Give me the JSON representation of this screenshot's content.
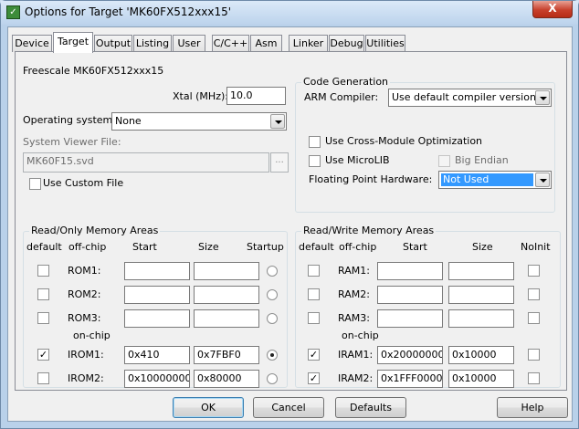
{
  "window": {
    "title": "Options for Target 'MK60FX512xxx15'",
    "close_glyph": "X"
  },
  "tabs": [
    "Device",
    "Target",
    "Output",
    "Listing",
    "User",
    "C/C++",
    "Asm",
    "Linker",
    "Debug",
    "Utilities"
  ],
  "active_tab": "Target",
  "target": {
    "device_name": "Freescale MK60FX512xxx15",
    "xtal_label": "Xtal (MHz):",
    "xtal_value": "10.0",
    "os_label": "Operating system:",
    "os_value": "None",
    "sv_file_label": "System Viewer File:",
    "sv_file_value": "MK60F15.svd",
    "browse_label": "...",
    "custom_file_label": "Use Custom File",
    "custom_file_checked": false
  },
  "code_generation": {
    "title": "Code Generation",
    "compiler_label": "ARM Compiler:",
    "compiler_value": "Use default compiler version",
    "cross_module_label": "Use Cross-Module Optimization",
    "cross_module_checked": false,
    "microlib_label": "Use MicroLIB",
    "microlib_checked": false,
    "big_endian_label": "Big Endian",
    "big_endian_checked": false,
    "fph_label": "Floating Point Hardware:",
    "fph_value": "Not Used"
  },
  "rom": {
    "title": "Read/Only Memory Areas",
    "headers": {
      "default": "default",
      "offchip": "off-chip",
      "start": "Start",
      "size": "Size",
      "startup": "Startup"
    },
    "onchip_label": "on-chip",
    "rows": [
      {
        "name": "ROM1:",
        "default": false,
        "start": "",
        "size": "",
        "startup": false
      },
      {
        "name": "ROM2:",
        "default": false,
        "start": "",
        "size": "",
        "startup": false
      },
      {
        "name": "ROM3:",
        "default": false,
        "start": "",
        "size": "",
        "startup": false
      },
      {
        "name": "IROM1:",
        "default": true,
        "start": "0x410",
        "size": "0x7FBF0",
        "startup": true
      },
      {
        "name": "IROM2:",
        "default": false,
        "start": "0x10000000",
        "size": "0x80000",
        "startup": false
      }
    ]
  },
  "ram": {
    "title": "Read/Write Memory Areas",
    "headers": {
      "default": "default",
      "offchip": "off-chip",
      "start": "Start",
      "size": "Size",
      "noinit": "NoInit"
    },
    "onchip_label": "on-chip",
    "rows": [
      {
        "name": "RAM1:",
        "default": false,
        "start": "",
        "size": "",
        "noinit": false
      },
      {
        "name": "RAM2:",
        "default": false,
        "start": "",
        "size": "",
        "noinit": false
      },
      {
        "name": "RAM3:",
        "default": false,
        "start": "",
        "size": "",
        "noinit": false
      },
      {
        "name": "IRAM1:",
        "default": true,
        "start": "0x20000000",
        "size": "0x10000",
        "noinit": false
      },
      {
        "name": "IRAM2:",
        "default": true,
        "start": "0x1FFF0000",
        "size": "0x10000",
        "noinit": false
      }
    ]
  },
  "buttons": {
    "ok": "OK",
    "cancel": "Cancel",
    "defaults": "Defaults",
    "help": "Help"
  },
  "icons": {
    "app": "keil-uvision-icon",
    "close": "close-icon",
    "dropdown": "chevron-down-icon",
    "radio": "radio-icon",
    "check": "checkbox-icon"
  },
  "check_glyph": "✓"
}
